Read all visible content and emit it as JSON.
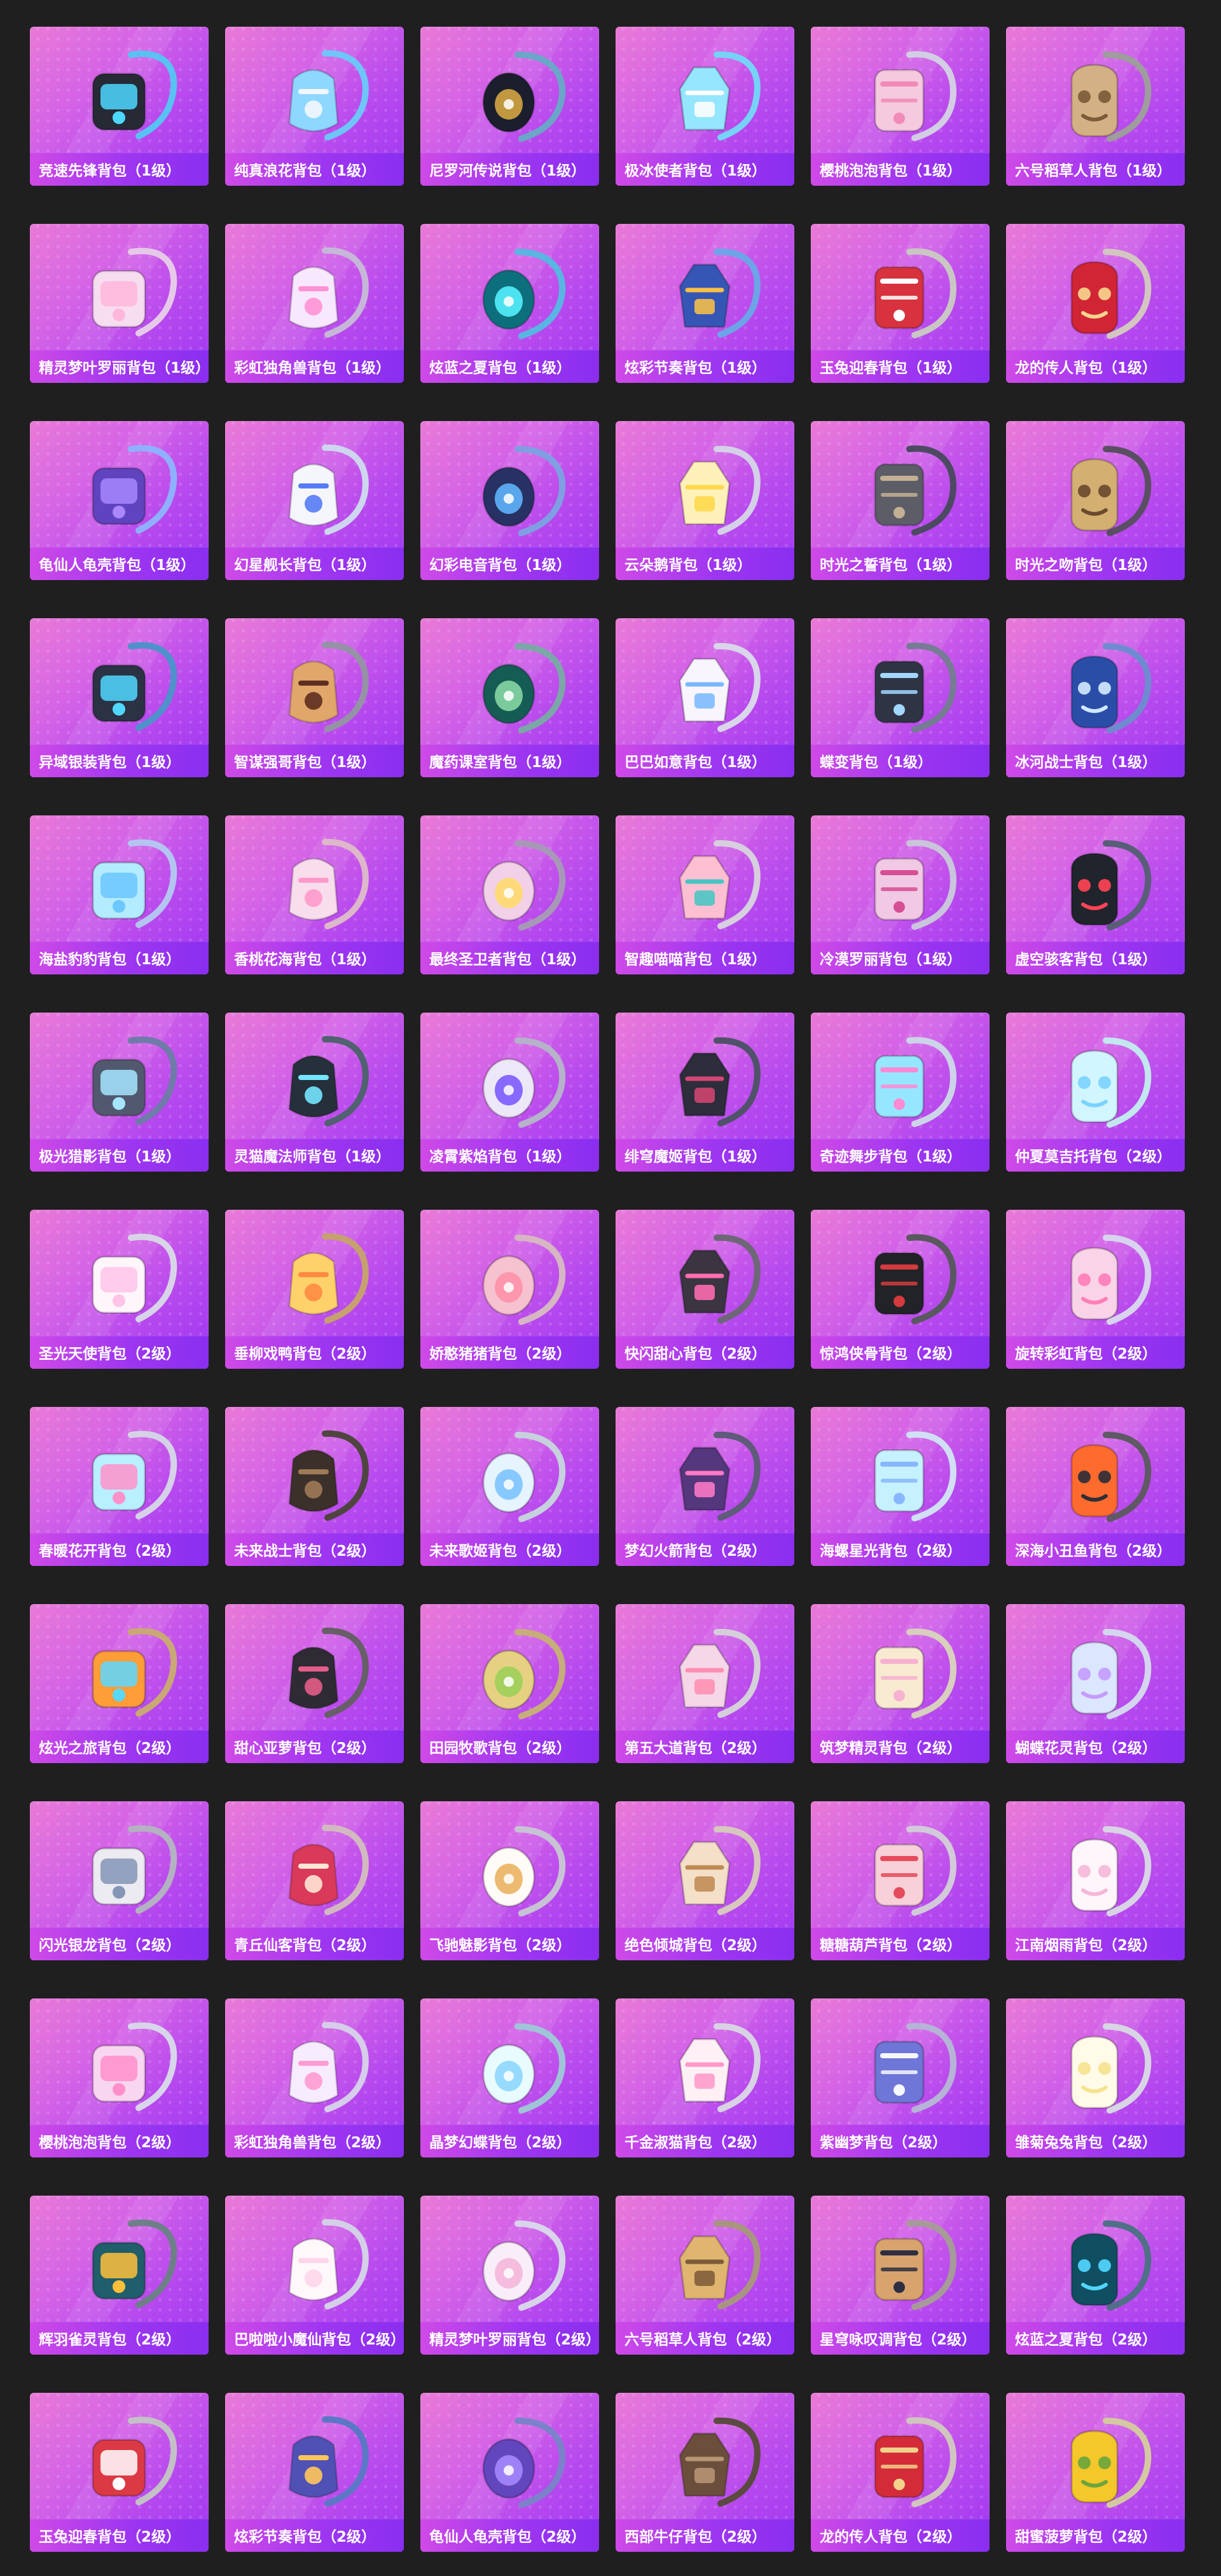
{
  "items": [
    {
      "label": "竞速先锋背包（1级）",
      "icon": "backpack-icon",
      "strap": "#58c2f2",
      "body": "#262a35",
      "accent": "#4cd7ff"
    },
    {
      "label": "纯真浪花背包（1级）",
      "icon": "backpack-icon",
      "strap": "#6ec5f7",
      "body": "#8ed8ff",
      "accent": "#f3f7ff"
    },
    {
      "label": "尼罗河传说背包（1级）",
      "icon": "backpack-icon",
      "strap": "#6aa6c8",
      "body": "#1b1f2d",
      "accent": "#d8aa43"
    },
    {
      "label": "极冰使者背包（1级）",
      "icon": "backpack-icon",
      "strap": "#76d2f6",
      "body": "#94e7ff",
      "accent": "#ffffff"
    },
    {
      "label": "樱桃泡泡背包（1级）",
      "icon": "backpack-icon",
      "strap": "#d2cde3",
      "body": "#f5c9de",
      "accent": "#f28ab8"
    },
    {
      "label": "六号稻草人背包（1级）",
      "icon": "backpack-icon",
      "strap": "#9e9c9c",
      "body": "#d4b185",
      "accent": "#7c5b39"
    },
    {
      "label": "精灵梦叶罗丽背包（1级）",
      "icon": "backpack-icon",
      "strap": "#e6c9e8",
      "body": "#f7ddf0",
      "accent": "#ffb7dc"
    },
    {
      "label": "彩虹独角兽背包（1级）",
      "icon": "backpack-icon",
      "strap": "#c6b7d8",
      "body": "#f7e8ff",
      "accent": "#ff92d4"
    },
    {
      "label": "炫蓝之夏背包（1级）",
      "icon": "backpack-icon",
      "strap": "#59b5e2",
      "body": "#0e6f7c",
      "accent": "#56f2ff"
    },
    {
      "label": "炫彩节奏背包（1级）",
      "icon": "backpack-icon",
      "strap": "#6da4e7",
      "body": "#3656b5",
      "accent": "#f8c047"
    },
    {
      "label": "玉兔迎春背包（1级）",
      "icon": "backpack-icon",
      "strap": "#c9c6c4",
      "body": "#d7323e",
      "accent": "#ffffff"
    },
    {
      "label": "龙的传人背包（1级）",
      "icon": "backpack-icon",
      "strap": "#d3c6c0",
      "body": "#d12535",
      "accent": "#f5d48c"
    },
    {
      "label": "龟仙人龟壳背包（1级）",
      "icon": "backpack-icon",
      "strap": "#8fb0ff",
      "body": "#6043be",
      "accent": "#a887ff"
    },
    {
      "label": "幻星舰长背包（1级）",
      "icon": "backpack-icon",
      "strap": "#cdd6ee",
      "body": "#f5f6fc",
      "accent": "#577bf6"
    },
    {
      "label": "幻彩电音背包（1级）",
      "icon": "backpack-icon",
      "strap": "#7f9fe2",
      "body": "#283163",
      "accent": "#60b6ff"
    },
    {
      "label": "云朵鹅背包（1级）",
      "icon": "backpack-icon",
      "strap": "#d4d0e7",
      "body": "#fff1b9",
      "accent": "#ffd84a"
    },
    {
      "label": "时光之誓背包（1级）",
      "icon": "backpack-icon",
      "strap": "#4c4a63",
      "body": "#5c5d67",
      "accent": "#c3b094"
    },
    {
      "label": "时光之吻背包（1级）",
      "icon": "backpack-icon",
      "strap": "#5a4e63",
      "body": "#d3b071",
      "accent": "#6b4b2f"
    },
    {
      "label": "异域银装背包（1级）",
      "icon": "backpack-icon",
      "strap": "#4f91cb",
      "body": "#2b3244",
      "accent": "#50d7ff"
    },
    {
      "label": "智谋强哥背包（1级）",
      "icon": "backpack-icon",
      "strap": "#9692a6",
      "body": "#e0a66a",
      "accent": "#5e2f20"
    },
    {
      "label": "魔药课室背包（1级）",
      "icon": "backpack-icon",
      "strap": "#7ba7a7",
      "body": "#155c54",
      "accent": "#89d9a5"
    },
    {
      "label": "巴巴如意背包（1级）",
      "icon": "backpack-icon",
      "strap": "#d9d5ea",
      "body": "#f9f5ff",
      "accent": "#79b9ff"
    },
    {
      "label": "蝶变背包（1级）",
      "icon": "backpack-icon",
      "strap": "#757c94",
      "body": "#2f3445",
      "accent": "#a2d7ff"
    },
    {
      "label": "冰河战士背包（1级）",
      "icon": "backpack-icon",
      "strap": "#6f8bd0",
      "body": "#2a4ea8",
      "accent": "#d1e8ff"
    },
    {
      "label": "海盐豹豹背包（1级）",
      "icon": "backpack-icon",
      "strap": "#b4c4f1",
      "body": "#b3ecff",
      "accent": "#6cc7ff"
    },
    {
      "label": "香桃花海背包（1级）",
      "icon": "backpack-icon",
      "strap": "#ddb7ca",
      "body": "#f8ddec",
      "accent": "#ff9acb"
    },
    {
      "label": "最终圣卫者背包（1级）",
      "icon": "backpack-icon",
      "strap": "#a798b8",
      "body": "#f1d0e8",
      "accent": "#ffd96a"
    },
    {
      "label": "智趣喵喵背包（1级）",
      "icon": "backpack-icon",
      "strap": "#d7cede",
      "body": "#ffbfd2",
      "accent": "#47c6c1"
    },
    {
      "label": "冷漠罗丽背包（1级）",
      "icon": "backpack-icon",
      "strap": "#c9c5db",
      "body": "#f1c9e4",
      "accent": "#d64f95"
    },
    {
      "label": "虚空骇客背包（1级）",
      "icon": "backpack-icon",
      "strap": "#595e78",
      "body": "#20242d",
      "accent": "#ff4456"
    },
    {
      "label": "极光猎影背包（1级）",
      "icon": "backpack-icon",
      "strap": "#6f7ba8",
      "body": "#52596f",
      "accent": "#a4e6ff"
    },
    {
      "label": "灵猫魔法师背包（1级）",
      "icon": "backpack-icon",
      "strap": "#50616f",
      "body": "#26303a",
      "accent": "#74e5ff"
    },
    {
      "label": "凌霄紫焰背包（1级）",
      "icon": "backpack-icon",
      "strap": "#b5b2ca",
      "body": "#ede8f8",
      "accent": "#7a56ff"
    },
    {
      "label": "绯穹魔姬背包（1级）",
      "icon": "backpack-icon",
      "strap": "#50526a",
      "body": "#2d2d3c",
      "accent": "#d44672"
    },
    {
      "label": "奇迹舞步背包（1级）",
      "icon": "backpack-icon",
      "strap": "#ccd4e8",
      "body": "#95e7ff",
      "accent": "#ff8ad4"
    },
    {
      "label": "仲夏莫吉托背包（2级）",
      "icon": "backpack-icon",
      "strap": "#c2e7ef",
      "body": "#d2f6ff",
      "accent": "#7bd3ff"
    },
    {
      "label": "圣光天使背包（2级）",
      "icon": "backpack-icon",
      "strap": "#d8d4e7",
      "body": "#fff6fb",
      "accent": "#ffc4e7"
    },
    {
      "label": "垂柳戏鸭背包（2级）",
      "icon": "backpack-icon",
      "strap": "#c6a06f",
      "body": "#ffd16a",
      "accent": "#ff8b42"
    },
    {
      "label": "娇憨猪猪背包（2级）",
      "icon": "backpack-icon",
      "strap": "#d7b6c3",
      "body": "#f7c2d0",
      "accent": "#ff8fa9"
    },
    {
      "label": "快闪甜心背包（2级）",
      "icon": "backpack-icon",
      "strap": "#6e6777",
      "body": "#3b3542",
      "accent": "#ff6db0"
    },
    {
      "label": "惊鸿侠骨背包（2级）",
      "icon": "backpack-icon",
      "strap": "#59585f",
      "body": "#222326",
      "accent": "#d43a3f"
    },
    {
      "label": "旋转彩虹背包（2级）",
      "icon": "backpack-icon",
      "strap": "#d8d3ee",
      "body": "#f9d3e7",
      "accent": "#ff7eb8"
    },
    {
      "label": "春暖花开背包（2级）",
      "icon": "backpack-icon",
      "strap": "#d5d1e7",
      "body": "#b8f0ff",
      "accent": "#ff92cb"
    },
    {
      "label": "未来战士背包（2级）",
      "icon": "backpack-icon",
      "strap": "#4f4540",
      "body": "#3c302b",
      "accent": "#9f7a56"
    },
    {
      "label": "未来歌姬背包（2级）",
      "icon": "backpack-icon",
      "strap": "#c6d1dd",
      "body": "#e5f4ff",
      "accent": "#7ac3ff"
    },
    {
      "label": "梦幻火箭背包（2级）",
      "icon": "backpack-icon",
      "strap": "#5f5b7a",
      "body": "#54377c",
      "accent": "#ff7ac6"
    },
    {
      "label": "海螺星光背包（2级）",
      "icon": "backpack-icon",
      "strap": "#d0dff4",
      "body": "#c6f2ff",
      "accent": "#89b7ff"
    },
    {
      "label": "深海小丑鱼背包（2级）",
      "icon": "backpack-icon",
      "strap": "#5f5964",
      "body": "#ff6b2e",
      "accent": "#2f2f38"
    },
    {
      "label": "炫光之旅背包（2级）",
      "icon": "backpack-icon",
      "strap": "#c9a875",
      "body": "#ff9d36",
      "accent": "#5ad8ff"
    },
    {
      "label": "甜心亚萝背包（2级）",
      "icon": "backpack-icon",
      "strap": "#675f67",
      "body": "#2f2b34",
      "accent": "#e45d88"
    },
    {
      "label": "田园牧歌背包（2级）",
      "icon": "backpack-icon",
      "strap": "#c7ad7a",
      "body": "#e5d181",
      "accent": "#9bcf58"
    },
    {
      "label": "第五大道背包（2级）",
      "icon": "backpack-icon",
      "strap": "#d5cfda",
      "body": "#f5d7e8",
      "accent": "#ff8fb0"
    },
    {
      "label": "筑梦精灵背包（2级）",
      "icon": "backpack-icon",
      "strap": "#d8cfbe",
      "body": "#f8ead1",
      "accent": "#f6b2d0"
    },
    {
      "label": "蝴蝶花灵背包（2级）",
      "icon": "backpack-icon",
      "strap": "#d4d6ef",
      "body": "#dbe6ff",
      "accent": "#c59cff"
    },
    {
      "label": "闪光银龙背包（2级）",
      "icon": "backpack-icon",
      "strap": "#b4b1c2",
      "body": "#ecebf2",
      "accent": "#8495b5"
    },
    {
      "label": "青丘仙客背包（2级）",
      "icon": "backpack-icon",
      "strap": "#d2b9bf",
      "body": "#d93a59",
      "accent": "#ffe6d4"
    },
    {
      "label": "飞驰魅影背包（2级）",
      "icon": "backpack-icon",
      "strap": "#c8c3d4",
      "body": "#fffcf7",
      "accent": "#e9b05d"
    },
    {
      "label": "绝色倾城背包（2级）",
      "icon": "backpack-icon",
      "strap": "#d7c7be",
      "body": "#f4dfc9",
      "accent": "#bf8b52"
    },
    {
      "label": "糖糖葫芦背包（2级）",
      "icon": "backpack-icon",
      "strap": "#d2cad9",
      "body": "#f8d0d7",
      "accent": "#e54b5b"
    },
    {
      "label": "江南烟雨背包（2级）",
      "icon": "backpack-icon",
      "strap": "#d8d4e5",
      "body": "#fff6fc",
      "accent": "#f5b8d8"
    },
    {
      "label": "樱桃泡泡背包（2级）",
      "icon": "backpack-icon",
      "strap": "#d8d4ea",
      "body": "#f9d6f0",
      "accent": "#ff8fcb"
    },
    {
      "label": "彩虹独角兽背包（2级）",
      "icon": "backpack-icon",
      "strap": "#d5cde9",
      "body": "#f7ecff",
      "accent": "#ff9bd3"
    },
    {
      "label": "晶梦幻蝶背包（2级）",
      "icon": "backpack-icon",
      "strap": "#9fc4d8",
      "body": "#e8fbff",
      "accent": "#8ad6ff"
    },
    {
      "label": "千金淑猫背包（2级）",
      "icon": "backpack-icon",
      "strap": "#d8d2e4",
      "body": "#fff0f6",
      "accent": "#ff98c8"
    },
    {
      "label": "紫幽梦背包（2级）",
      "icon": "backpack-icon",
      "strap": "#b6b3d6",
      "body": "#6e77d7",
      "accent": "#f7f8ff"
    },
    {
      "label": "雏菊兔兔背包（2级）",
      "icon": "backpack-icon",
      "strap": "#d7d5e4",
      "body": "#fffbe8",
      "accent": "#f7e28f"
    },
    {
      "label": "辉羽雀灵背包（2级）",
      "icon": "backpack-icon",
      "strap": "#6d8088",
      "body": "#1f5e6a",
      "accent": "#ffbf3b"
    },
    {
      "label": "巴啦啦小魔仙背包（2级）",
      "icon": "backpack-icon",
      "strap": "#d3cfe6",
      "body": "#fff8fb",
      "accent": "#ffd5ea"
    },
    {
      "label": "精灵梦叶罗丽背包（2级）",
      "icon": "backpack-icon",
      "strap": "#d8d4ea",
      "body": "#f8edf8",
      "accent": "#f4b5d8"
    },
    {
      "label": "六号稻草人背包（2级）",
      "icon": "backpack-icon",
      "strap": "#a8957f",
      "body": "#e0b56f",
      "accent": "#7d5c3a"
    },
    {
      "label": "星穹咏叹调背包（2级）",
      "icon": "backpack-icon",
      "strap": "#a69b98",
      "body": "#d8a36c",
      "accent": "#2d2f42"
    },
    {
      "label": "炫蓝之夏背包（2级）",
      "icon": "backpack-icon",
      "strap": "#4f7087",
      "body": "#0f4f61",
      "accent": "#52d5ff"
    },
    {
      "label": "玉兔迎春背包（2级）",
      "icon": "backpack-icon",
      "strap": "#c3c1c6",
      "body": "#db3a44",
      "accent": "#ffffff"
    },
    {
      "label": "炫彩节奏背包（2级）",
      "icon": "backpack-icon",
      "strap": "#5b78c6",
      "body": "#4f52b4",
      "accent": "#ffc65b"
    },
    {
      "label": "龟仙人龟壳背包（2级）",
      "icon": "backpack-icon",
      "strap": "#7b82ca",
      "body": "#6146bd",
      "accent": "#a78aff"
    },
    {
      "label": "西部牛仔背包（2级）",
      "icon": "backpack-icon",
      "strap": "#5b4a40",
      "body": "#6b4f3c",
      "accent": "#b79574"
    },
    {
      "label": "龙的传人背包（2级）",
      "icon": "backpack-icon",
      "strap": "#d1c5bf",
      "body": "#d42b39",
      "accent": "#f2d189"
    },
    {
      "label": "甜蜜菠萝背包（2级）",
      "icon": "backpack-icon",
      "strap": "#d4c8a1",
      "body": "#f4c72b",
      "accent": "#6ba53c"
    }
  ]
}
